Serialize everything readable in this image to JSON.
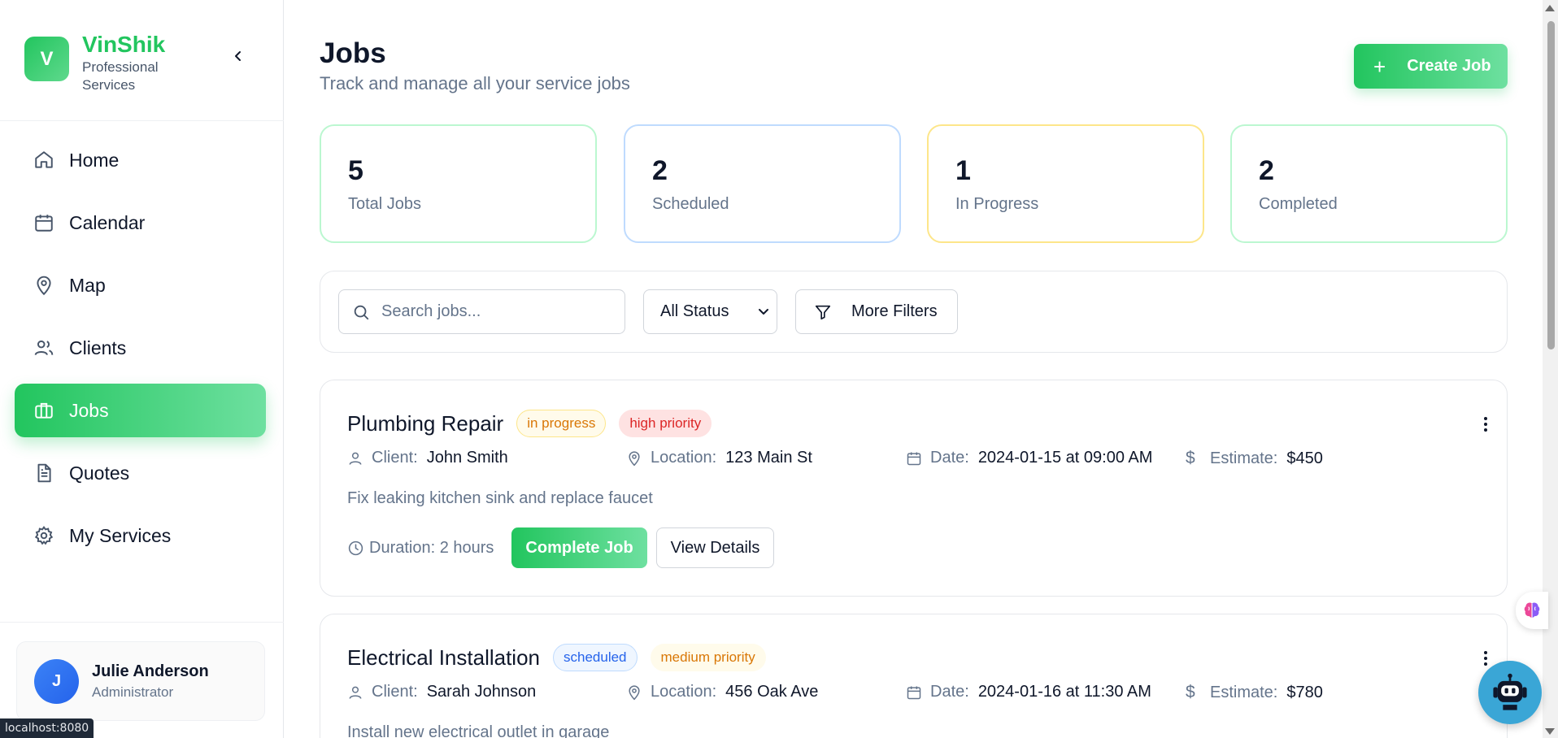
{
  "brand": {
    "initial": "V",
    "name": "VinShik",
    "subtitle": "Professional Services"
  },
  "nav": [
    {
      "label": "Home",
      "icon": "home-icon"
    },
    {
      "label": "Calendar",
      "icon": "calendar-icon"
    },
    {
      "label": "Map",
      "icon": "map-pin-icon"
    },
    {
      "label": "Clients",
      "icon": "users-icon"
    },
    {
      "label": "Jobs",
      "icon": "briefcase-icon",
      "active": true
    },
    {
      "label": "Quotes",
      "icon": "file-text-icon"
    },
    {
      "label": "My Services",
      "icon": "gear-icon"
    }
  ],
  "user": {
    "initial": "J",
    "name": "Julie Anderson",
    "role": "Administrator"
  },
  "status_url": "localhost:8080",
  "header": {
    "title": "Jobs",
    "subtitle": "Track and manage all your service jobs",
    "create_label": "Create Job"
  },
  "stats": [
    {
      "value": "5",
      "label": "Total Jobs",
      "color": "#bbf7d0"
    },
    {
      "value": "2",
      "label": "Scheduled",
      "color": "#bfdbfe"
    },
    {
      "value": "1",
      "label": "In Progress",
      "color": "#fde68a"
    },
    {
      "value": "2",
      "label": "Completed",
      "color": "#bbf7d0"
    }
  ],
  "filters": {
    "search_placeholder": "Search jobs...",
    "status_value": "All Status",
    "more_label": "More Filters"
  },
  "jobs": [
    {
      "title": "Plumbing Repair",
      "status": "in progress",
      "priority": "high priority",
      "client_label": "Client:",
      "client": "John Smith",
      "location_label": "Location:",
      "location": "123 Main St",
      "date_label": "Date:",
      "date": "2024-01-15 at 09:00 AM",
      "estimate_label": "Estimate:",
      "estimate": "$450",
      "description": "Fix leaking kitchen sink and replace faucet",
      "duration": "Duration: 2 hours",
      "complete_label": "Complete Job",
      "details_label": "View Details"
    },
    {
      "title": "Electrical Installation",
      "status": "scheduled",
      "priority": "medium priority",
      "client_label": "Client:",
      "client": "Sarah Johnson",
      "location_label": "Location:",
      "location": "456 Oak Ave",
      "date_label": "Date:",
      "date": "2024-01-16 at 11:30 AM",
      "estimate_label": "Estimate:",
      "estimate": "$780",
      "description": "Install new electrical outlet in garage"
    }
  ],
  "colors": {
    "accent": "#22c55e",
    "text": "#0f172a",
    "muted": "#64748b"
  }
}
